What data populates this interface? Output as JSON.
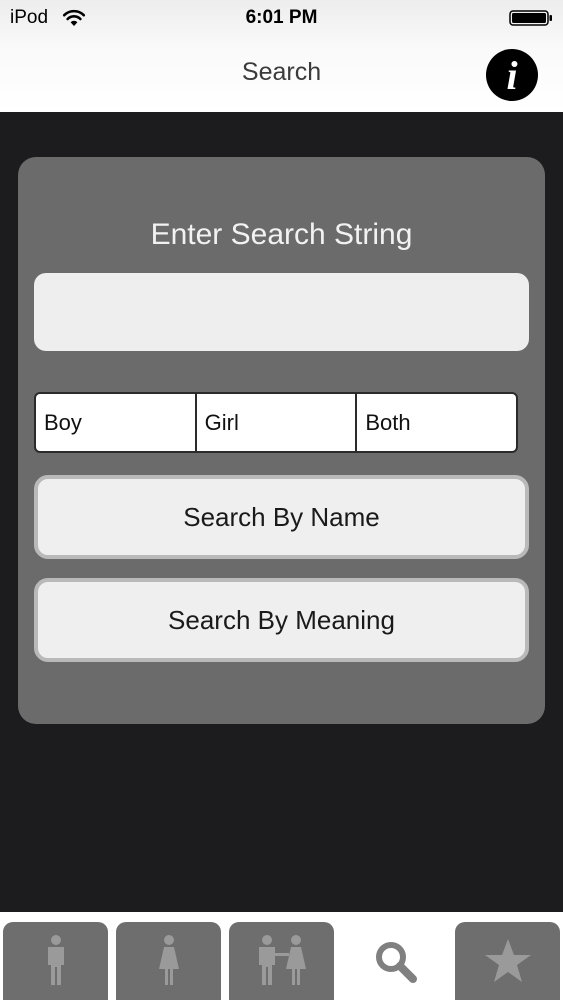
{
  "status_bar": {
    "carrier": "iPod",
    "time": "6:01 PM"
  },
  "nav": {
    "title": "Search",
    "info_label": "i"
  },
  "panel": {
    "heading": "Enter Search String",
    "search_input": {
      "value": "",
      "placeholder": ""
    },
    "gender_options": [
      "Boy",
      "Girl",
      "Both"
    ],
    "buttons": {
      "by_name": "Search By Name",
      "by_meaning": "Search By Meaning"
    }
  },
  "tabs": [
    {
      "icon": "male-icon",
      "active": false
    },
    {
      "icon": "female-icon",
      "active": false
    },
    {
      "icon": "couple-icon",
      "active": false
    },
    {
      "icon": "search-icon",
      "active": true
    },
    {
      "icon": "star-icon",
      "active": false
    }
  ],
  "colors": {
    "background": "#1c1b1d",
    "panel": "#6b6b6b",
    "tab_inactive": "#6e6e6e",
    "tab_icon": "#9a9a9a",
    "tab_icon_active": "#808080"
  }
}
